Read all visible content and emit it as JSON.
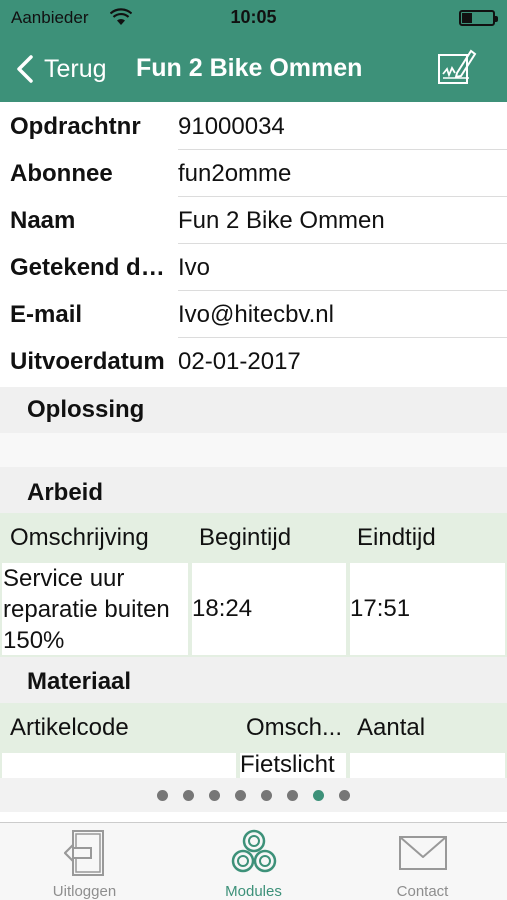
{
  "status_bar": {
    "carrier": "Aanbieder",
    "time": "10:05"
  },
  "nav": {
    "back_label": "Terug",
    "title": "Fun 2 Bike Ommen"
  },
  "details": [
    {
      "label": "Opdrachtnr",
      "value": "91000034"
    },
    {
      "label": "Abonnee",
      "value": "fun2omme"
    },
    {
      "label": "Naam",
      "value": "Fun 2 Bike Ommen"
    },
    {
      "label": "Getekend door",
      "value": "Ivo"
    },
    {
      "label": "E-mail",
      "value": "Ivo@hitecbv.nl"
    },
    {
      "label": "Uitvoerdatum",
      "value": "02-01-2017"
    }
  ],
  "sections": {
    "oplossing": "Oplossing",
    "arbeid": "Arbeid",
    "materiaal": "Materiaal"
  },
  "arbeid_table": {
    "headers": [
      "Omschrijving",
      "Begintijd",
      "Eindtijd"
    ],
    "rows": [
      {
        "omschrijving": "Service uur reparatie buiten 150%",
        "begintijd": "18:24",
        "eindtijd": "17:51"
      }
    ]
  },
  "materiaal_table": {
    "headers": [
      "Artikelcode",
      "Omsch...",
      "Aantal"
    ],
    "rows": [
      {
        "artikelcode": "",
        "omschrijving": "Fietslicht",
        "aantal": ""
      }
    ]
  },
  "pager": {
    "count": 8,
    "active_index": 6
  },
  "tabs": [
    {
      "label": "Uitloggen",
      "icon": "logout-icon"
    },
    {
      "label": "Modules",
      "icon": "modules-icon"
    },
    {
      "label": "Contact",
      "icon": "mail-icon"
    }
  ],
  "colors": {
    "brand": "#3d9179",
    "table_header": "#e4efe2",
    "section_bg": "#f0f0f0"
  }
}
